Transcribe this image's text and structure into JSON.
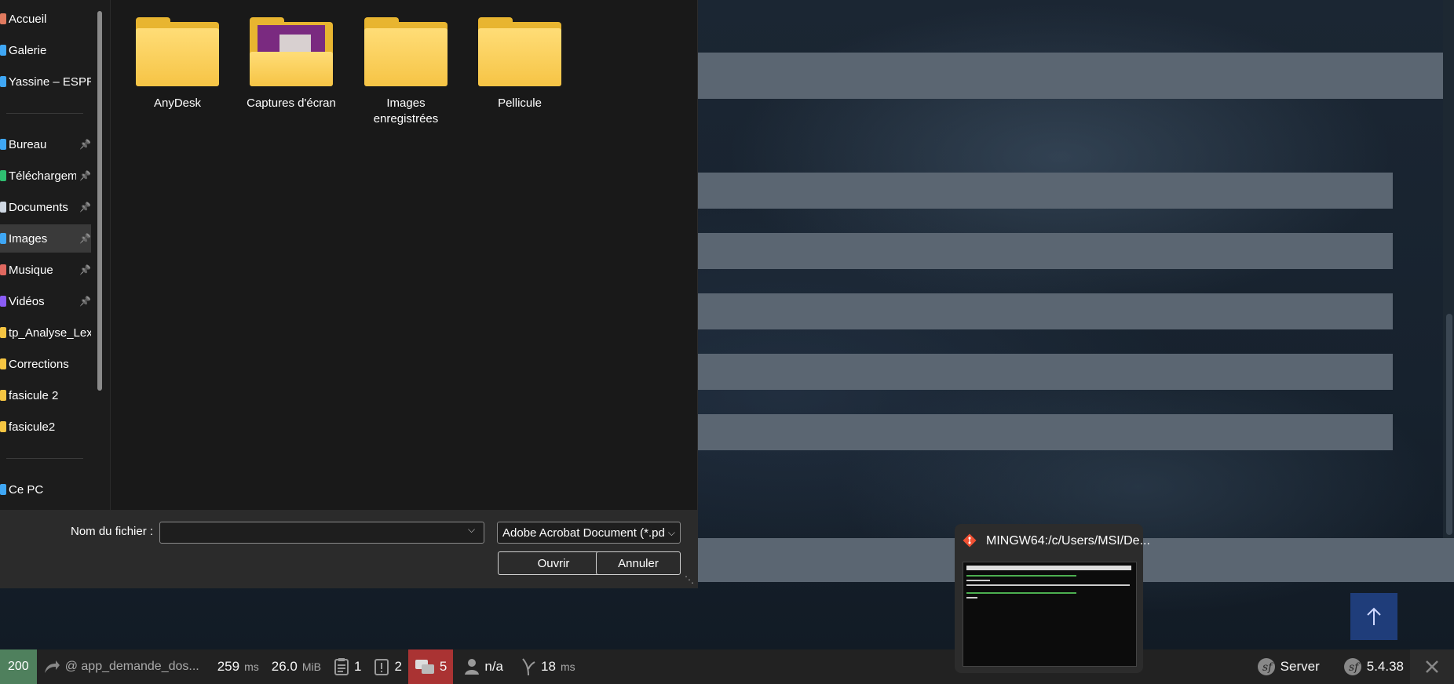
{
  "dialog": {
    "nav": {
      "items": [
        {
          "label": "Accueil",
          "color": "#e07a5f"
        },
        {
          "label": "Galerie",
          "color": "#3fa7f5"
        },
        {
          "label": "Yassine – ESPRIT",
          "color": "#3fa7f5"
        },
        {
          "label": "Bureau",
          "color": "#3fa7f5",
          "pinned": true
        },
        {
          "label": "Téléchargements",
          "color": "#2fbf71",
          "pinned": true
        },
        {
          "label": "Documents",
          "color": "#cfd8e3",
          "pinned": true
        },
        {
          "label": "Images",
          "color": "#3fa7f5",
          "pinned": true,
          "selected": true
        },
        {
          "label": "Musique",
          "color": "#e0685f",
          "pinned": true
        },
        {
          "label": "Vidéos",
          "color": "#8a5cf6",
          "pinned": true
        },
        {
          "label": "tp_Analyse_Lex",
          "color": "#f5c542"
        },
        {
          "label": "Corrections",
          "color": "#f5c542"
        },
        {
          "label": "fasicule 2",
          "color": "#f5c542"
        },
        {
          "label": "fasicule2",
          "color": "#f5c542"
        },
        {
          "label": "Ce PC",
          "color": "#3fa7f5"
        }
      ]
    },
    "folders": [
      {
        "label": "AnyDesk"
      },
      {
        "label": "Captures d'écran"
      },
      {
        "label": "Images enregistrées"
      },
      {
        "label": "Pellicule"
      }
    ],
    "filename_label": "Nom du fichier :",
    "filename_value": "",
    "filter_value": "Adobe Acrobat Document (*.pdf)",
    "open_label": "Ouvrir",
    "cancel_label": "Annuler"
  },
  "taskbar_preview": {
    "title": "MINGW64:/c/Users/MSI/De..."
  },
  "sf_toolbar": {
    "status": "200",
    "route": "@ app_demande_dos...",
    "time_value": "259",
    "time_unit": "ms",
    "memory_value": "26.0",
    "memory_unit": "MiB",
    "forms_count": "1",
    "exceptions_count": "2",
    "logs_count": "5",
    "user": "n/a",
    "twig_value": "18",
    "twig_unit": "ms",
    "server_label": "Server",
    "version": "5.4.38"
  },
  "colors": {
    "sf_status": "#4f805d",
    "sf_red": "#a33333",
    "back_to_top": "#1f3d7a",
    "folder": "#f6c445"
  }
}
